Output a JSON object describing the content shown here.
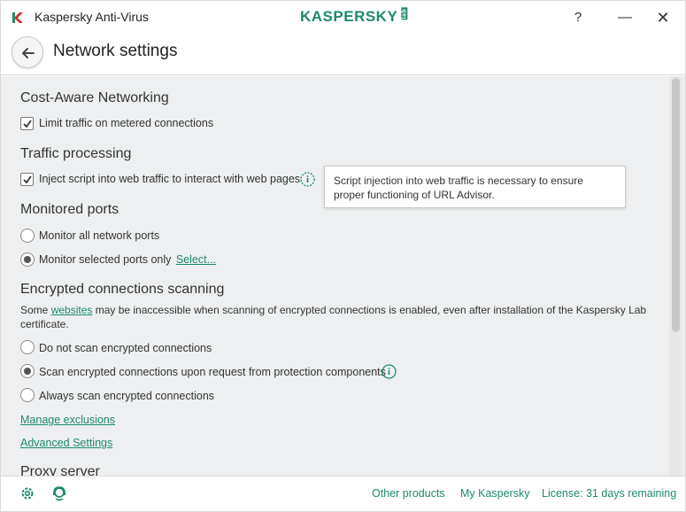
{
  "window": {
    "title": "Kaspersky Anti-Virus",
    "brand": "KASPERSKY",
    "brand_suffix": "lab",
    "help": "?",
    "minimize": "—",
    "close": "✕"
  },
  "header": {
    "title": "Network settings"
  },
  "sections": {
    "cost_aware": {
      "title": "Cost-Aware Networking",
      "limit_traffic": {
        "label": "Limit traffic on metered connections",
        "checked": true
      }
    },
    "traffic_processing": {
      "title": "Traffic processing",
      "inject_script": {
        "label": "Inject script into web traffic to interact with web pages",
        "checked": true
      },
      "tooltip": "Script injection into web traffic is necessary to ensure proper functioning of URL Advisor."
    },
    "monitored_ports": {
      "title": "Monitored ports",
      "all_ports": "Monitor all network ports",
      "selected_ports": "Monitor selected ports only",
      "select_link": "Select..."
    },
    "encrypted": {
      "title": "Encrypted connections scanning",
      "desc_before": "Some ",
      "desc_link": "websites",
      "desc_after": " may be inaccessible when scanning of encrypted connections is enabled, even after installation of the Kaspersky Lab certificate.",
      "option_none": "Do not scan encrypted connections",
      "option_request": "Scan encrypted connections upon request from protection components",
      "option_always": "Always scan encrypted connections",
      "manage_exclusions": "Manage exclusions",
      "advanced_settings": "Advanced Settings"
    },
    "proxy": {
      "title": "Proxy server"
    }
  },
  "footer": {
    "other_products": "Other products",
    "my_kaspersky": "My Kaspersky",
    "license": "License: 31 days remaining"
  },
  "colors": {
    "accent": "#1d8a6e",
    "content_bg": "#edeff0"
  }
}
